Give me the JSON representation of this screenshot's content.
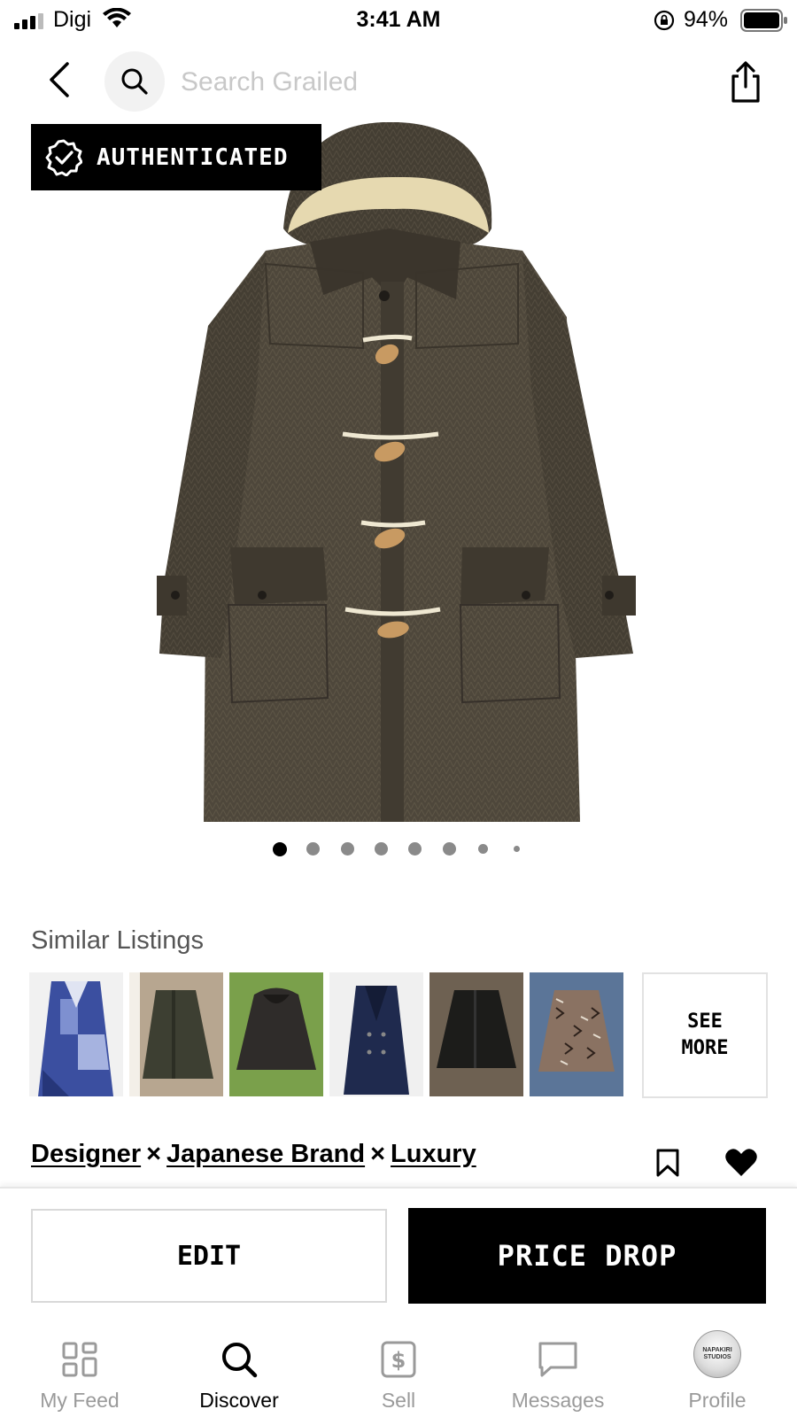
{
  "status_bar": {
    "carrier": "Digi",
    "time": "3:41 AM",
    "battery_percent": "94%"
  },
  "search": {
    "placeholder": "Search Grailed",
    "value": ""
  },
  "product": {
    "badge_label": "AUTHENTICATED",
    "image_count": 8,
    "active_image_index": 0
  },
  "similar": {
    "title": "Similar Listings",
    "see_more_line1": "SEE",
    "see_more_line2": "MORE",
    "thumbnails": [
      {
        "alt": "blue patchwork coat"
      },
      {
        "alt": "olive field jacket"
      },
      {
        "alt": "dark puffer jacket"
      },
      {
        "alt": "navy overcoat"
      },
      {
        "alt": "black utility jacket"
      },
      {
        "alt": "patterned wool coat"
      }
    ]
  },
  "designers": {
    "items": [
      "Designer",
      "Japanese Brand",
      "Luxury"
    ],
    "separator": "×"
  },
  "actions": {
    "edit_label": "EDIT",
    "price_drop_label": "PRICE DROP"
  },
  "tabs": [
    {
      "label": "My Feed",
      "icon": "grid-icon"
    },
    {
      "label": "Discover",
      "icon": "search-icon"
    },
    {
      "label": "Sell",
      "icon": "dollar-icon"
    },
    {
      "label": "Messages",
      "icon": "chat-icon"
    },
    {
      "label": "Profile",
      "icon": "avatar"
    }
  ],
  "profile_avatar_text": "NAPAKIRI STUDIOS",
  "colors": {
    "accent": "#000000",
    "coat": "#4a4438",
    "toggle": "#c89a62",
    "lining": "#e8dcb4"
  }
}
